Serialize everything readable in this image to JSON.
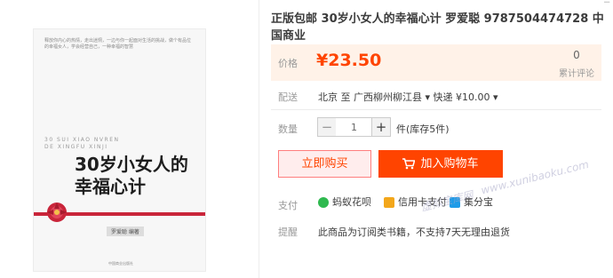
{
  "product": {
    "title": "正版包邮 30岁小女人的幸福心计 罗爱聪 9787504474728 中国商业",
    "price_label": "价格",
    "price": "¥23.50",
    "sales_count": "0",
    "sales_label": "累计评论",
    "shipping_label": "配送",
    "shipping_text": "北京 至 广西柳州柳江县 ▾   快递 ¥10.00 ▾",
    "quantity_label": "数量",
    "quantity_value": "1",
    "minus_symbol": "−",
    "plus_symbol": "+",
    "stock_text": "件(库存5件)",
    "buy_now": "立即购买",
    "add_to_cart": "加入购物车",
    "payment_label": "支付",
    "payments": [
      "蚂蚁花呗",
      "信用卡支付",
      "集分宝"
    ],
    "tips_label": "提醒",
    "tips_text": "此商品为订阅类书籍，不支持7天无理由退货"
  },
  "book": {
    "blurb": "释放你内心的热情，走出迷惘，一边与你一起面对生活的挑战，做个有品位的幸福女人，学会经营自己，一种幸福的智慧",
    "pinyin_line1": "30 SUI XIAO NVREN",
    "pinyin_line2": "DE XINGFU XINJI",
    "title_line1": "30岁小女人的",
    "title_line2": "幸福心计",
    "author": "罗爱聪 编著",
    "publisher": "中国商业出版社"
  },
  "watermark": {
    "url": "www.xunibaoku.com",
    "cn": "虚拟宝库网"
  },
  "colors": {
    "accent": "#ff4400",
    "price_bg": "#fff2e8",
    "ribbon": "#c9253a"
  },
  "icons": {
    "cart": "shopping-cart-icon",
    "huabei": "ant-huabei-icon",
    "credit_card": "credit-card-icon",
    "jifenbao": "jifenbao-icon"
  }
}
